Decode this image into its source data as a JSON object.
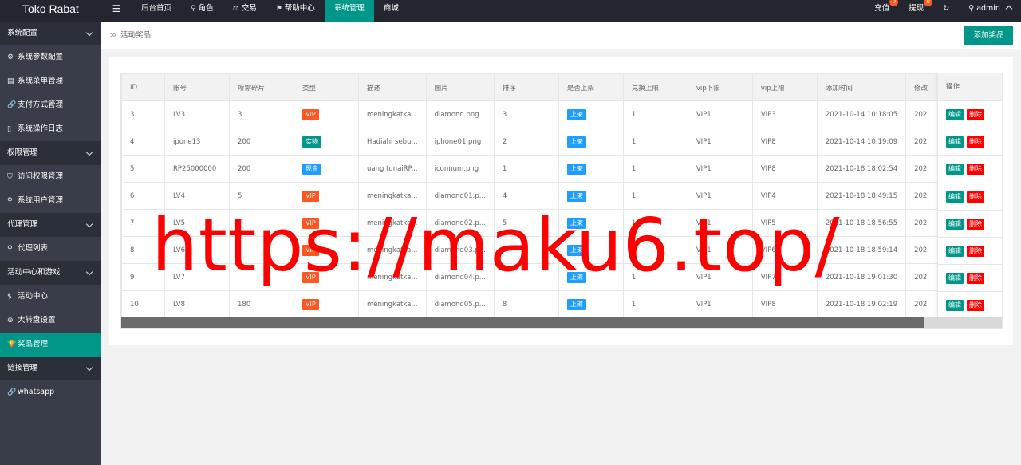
{
  "app": {
    "title": "Toko Rabat",
    "menu_toggle": "☰"
  },
  "topnav": [
    {
      "label": "后台首页",
      "icon": "",
      "active": false
    },
    {
      "label": "角色",
      "icon": "user-icon",
      "glyph": "⚲",
      "active": false
    },
    {
      "label": "交易",
      "icon": "scale-icon",
      "glyph": "⚖",
      "active": false
    },
    {
      "label": "帮助中心",
      "icon": "flag-icon",
      "glyph": "⚑",
      "active": false
    },
    {
      "label": "系统管理",
      "icon": "",
      "active": true
    },
    {
      "label": "商城",
      "icon": "",
      "active": false
    }
  ],
  "rightnav": {
    "recharge": "充值",
    "recharge_count": "0",
    "withdraw": "提现",
    "withdraw_count": "0",
    "refresh_glyph": "↻",
    "user": "admin"
  },
  "sidebar": {
    "groups": [
      {
        "label": "系统配置",
        "items": [
          {
            "label": "系统参数配置",
            "glyph": "⚙",
            "icon": "gear-icon"
          },
          {
            "label": "系统菜单管理",
            "glyph": "▤",
            "icon": "menu-icon"
          },
          {
            "label": "支付方式管理",
            "glyph": "🔗",
            "icon": "link-icon"
          },
          {
            "label": "系统操作日志",
            "glyph": "▯",
            "icon": "doc-icon"
          }
        ]
      },
      {
        "label": "权限管理",
        "items": [
          {
            "label": "访问权限管理",
            "glyph": "⛉",
            "icon": "shield-icon"
          },
          {
            "label": "系统用户管理",
            "glyph": "⚲",
            "icon": "user-icon"
          }
        ]
      },
      {
        "label": "代理管理",
        "items": [
          {
            "label": "代理列表",
            "glyph": "⚲",
            "icon": "user-icon"
          }
        ]
      },
      {
        "label": "活动中心和游戏",
        "items": [
          {
            "label": "活动中心",
            "glyph": "$",
            "icon": "dollar-icon"
          },
          {
            "label": "大转盘设置",
            "glyph": "⊕",
            "icon": "plus-circle-icon"
          },
          {
            "label": "奖品管理",
            "glyph": "🏆",
            "icon": "trophy-icon",
            "active": true
          }
        ]
      },
      {
        "label": "链接管理",
        "items": [
          {
            "label": "whatsapp",
            "glyph": "🔗",
            "icon": "link-icon"
          }
        ]
      }
    ]
  },
  "breadcrumb": {
    "sep": "≫",
    "current": "活动奖品"
  },
  "add_button": "添加奖品",
  "table": {
    "columns": [
      "ID",
      "账号",
      "所需碎片",
      "类型",
      "描述",
      "图片",
      "排序",
      "是否上架",
      "兑换上限",
      "vip下限",
      "vip上限",
      "添加时间",
      "修改"
    ],
    "op_header": "操作",
    "edit_label": "编辑",
    "delete_label": "删除",
    "rows": [
      {
        "id": "3",
        "account": "LV3",
        "shards": "3",
        "type": "VIP",
        "type_color": "orange",
        "desc": "meningkatka...",
        "image": "diamond.png",
        "sort": "3",
        "shelf": "上架",
        "limit": "1",
        "vip_min": "VIP1",
        "vip_max": "VIP3",
        "added": "2021-10-14 10:18:05",
        "modified": "202"
      },
      {
        "id": "4",
        "account": "ipone13",
        "shards": "200",
        "type": "实物",
        "type_color": "green",
        "desc": "Hadiahi sebu...",
        "image": "iphone01.png",
        "sort": "2",
        "shelf": "上架",
        "limit": "1",
        "vip_min": "VIP1",
        "vip_max": "VIP8",
        "added": "2021-10-14 10:19:09",
        "modified": "202"
      },
      {
        "id": "5",
        "account": "RP25000000",
        "shards": "200",
        "type": "现金",
        "type_color": "blue",
        "desc": "uang tunaiRP...",
        "image": "iconnum.png",
        "sort": "1",
        "shelf": "上架",
        "limit": "1",
        "vip_min": "VIP1",
        "vip_max": "VIP8",
        "added": "2021-10-18 18:02:54",
        "modified": "202"
      },
      {
        "id": "6",
        "account": "LV4",
        "shards": "5",
        "type": "VIP",
        "type_color": "orange",
        "desc": "meningkatka...",
        "image": "diamond01.p...",
        "sort": "4",
        "shelf": "上架",
        "limit": "1",
        "vip_min": "VIP1",
        "vip_max": "VIP4",
        "added": "2021-10-18 18:49:15",
        "modified": "202"
      },
      {
        "id": "7",
        "account": "LV5",
        "shards": "7",
        "type": "VIP",
        "type_color": "orange",
        "desc": "meningkatka...",
        "image": "diamond02.p...",
        "sort": "5",
        "shelf": "上架",
        "limit": "1",
        "vip_min": "VIP1",
        "vip_max": "VIP5",
        "added": "2021-10-18 18:56:55",
        "modified": "202"
      },
      {
        "id": "8",
        "account": "LV6",
        "shards": "",
        "type": "VIP",
        "type_color": "orange",
        "desc": "meningkatka...",
        "image": "diamond03.p...",
        "sort": "",
        "shelf": "上架",
        "limit": "1",
        "vip_min": "VIP1",
        "vip_max": "VIP6",
        "added": "2021-10-18 18:59:14",
        "modified": "202"
      },
      {
        "id": "9",
        "account": "LV7",
        "shards": "",
        "type": "VIP",
        "type_color": "orange",
        "desc": "meningkatka...",
        "image": "diamond04.p...",
        "sort": "",
        "shelf": "上架",
        "limit": "1",
        "vip_min": "VIP1",
        "vip_max": "VIP7",
        "added": "2021-10-18 19:01:30",
        "modified": "202"
      },
      {
        "id": "10",
        "account": "LV8",
        "shards": "180",
        "type": "VIP",
        "type_color": "orange",
        "desc": "meningkatka...",
        "image": "diamond05.p...",
        "sort": "8",
        "shelf": "上架",
        "limit": "1",
        "vip_min": "VIP1",
        "vip_max": "VIP8",
        "added": "2021-10-18 19:02:19",
        "modified": "202"
      }
    ]
  },
  "watermark": "https://maku6.top/"
}
